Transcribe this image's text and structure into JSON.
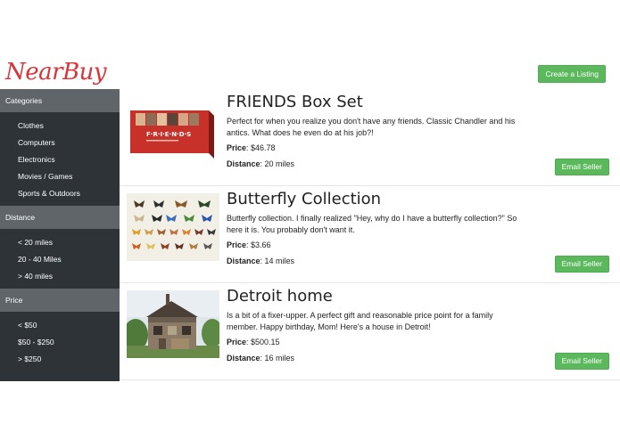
{
  "header": {
    "logo": "NearBuy",
    "create_label": "Create a Listing"
  },
  "sidebar": {
    "categories": {
      "heading": "Categories",
      "items": [
        "Clothes",
        "Computers",
        "Electronics",
        "Movies / Games",
        "Sports & Outdoors"
      ]
    },
    "distance": {
      "heading": "Distance",
      "items": [
        "< 20 miles",
        "20 - 40 Miles",
        "> 40 miles"
      ]
    },
    "price": {
      "heading": "Price",
      "items": [
        "< $50",
        "$50 - $250",
        "> $250"
      ]
    }
  },
  "listings": [
    {
      "title": "FRIENDS Box Set",
      "description": "Perfect for when you realize you don't have any friends. Classic Chandler and his antics. What does he even do at his job?!",
      "price_label": "Price",
      "price": ": $46.78",
      "distance_label": "Distance",
      "distance": ": 20 miles",
      "button": "Email Seller",
      "image_icon": "friends-box-set-image"
    },
    {
      "title": "Butterfly Collection",
      "description": "Butterfly collection. I finally realized \"Hey, why do I have a butterfly collection?\" So here it is. You probably don't want it.",
      "price_label": "Price",
      "price": ": $3.66",
      "distance_label": "Distance",
      "distance": ": 14 miles",
      "button": "Email Seller",
      "image_icon": "butterfly-collection-image"
    },
    {
      "title": "Detroit home",
      "description": "Is a bit of a fixer-upper. A perfect gift and reasonable price point for a family member. Happy birthday, Mom! Here's a house in Detroit!",
      "price_label": "Price",
      "price": ": $500.15",
      "distance_label": "Distance",
      "distance": ": 16 miles",
      "button": "Email Seller",
      "image_icon": "detroit-house-image"
    }
  ],
  "colors": {
    "brand": "#d8343a",
    "button": "#5cb85c",
    "sidebar": "#2e3338",
    "sidebar_heading": "#5f6569"
  }
}
